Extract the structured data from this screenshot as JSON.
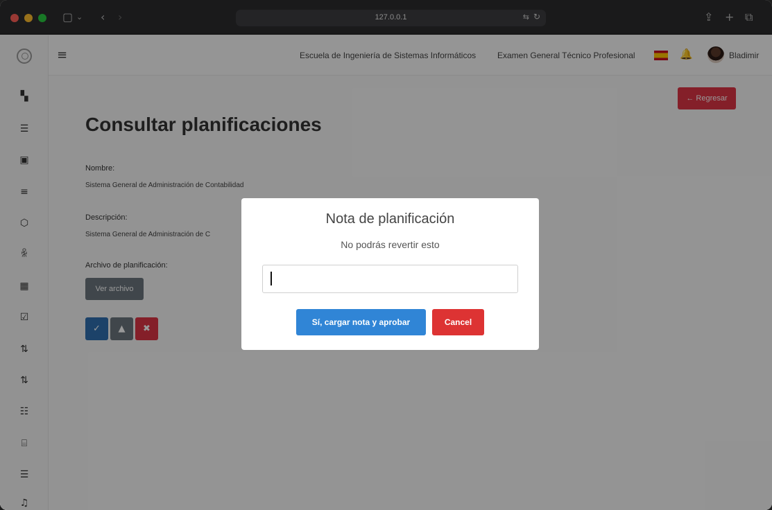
{
  "browser": {
    "url": "127.0.0.1"
  },
  "topbar": {
    "links": [
      "Escuela de Ingeniería de Sistemas Informáticos",
      "Examen General Técnico Profesional"
    ],
    "username": "Bladimir"
  },
  "sidebar": {
    "icons": [
      "dashboard-icon",
      "users-list-icon",
      "building-icon",
      "stack-icon",
      "settings-icon",
      "group-icon",
      "calendar-icon",
      "calendar-check-icon",
      "git-pull-request-icon",
      "git-pull-request-icon",
      "list-icon",
      "code-icon",
      "users-list-icon",
      "bell-icon"
    ]
  },
  "page": {
    "back_button": "← Regresar",
    "title": "Consultar planificaciones",
    "name_label": "Nombre:",
    "name_value": "Sistema General de Administración de Contabilidad",
    "description_label": "Descripción:",
    "description_value": "Sistema General de Administración de C",
    "file_label": "Archivo de planificación:",
    "view_file_button": "Ver archivo",
    "action_icons": [
      "check-icon",
      "warning-icon",
      "close-icon"
    ]
  },
  "modal": {
    "title": "Nota de planificación",
    "text": "No podrás revertir esto",
    "input_value": "",
    "confirm_button": "Sí, cargar nota y aprobar",
    "cancel_button": "Cancel"
  },
  "colors": {
    "confirm": "#3085d6",
    "cancel": "#dd3333",
    "danger": "#dc3545",
    "action_check": "#2f6fb0",
    "action_warning": "#6c757d",
    "action_close": "#dc3545"
  }
}
